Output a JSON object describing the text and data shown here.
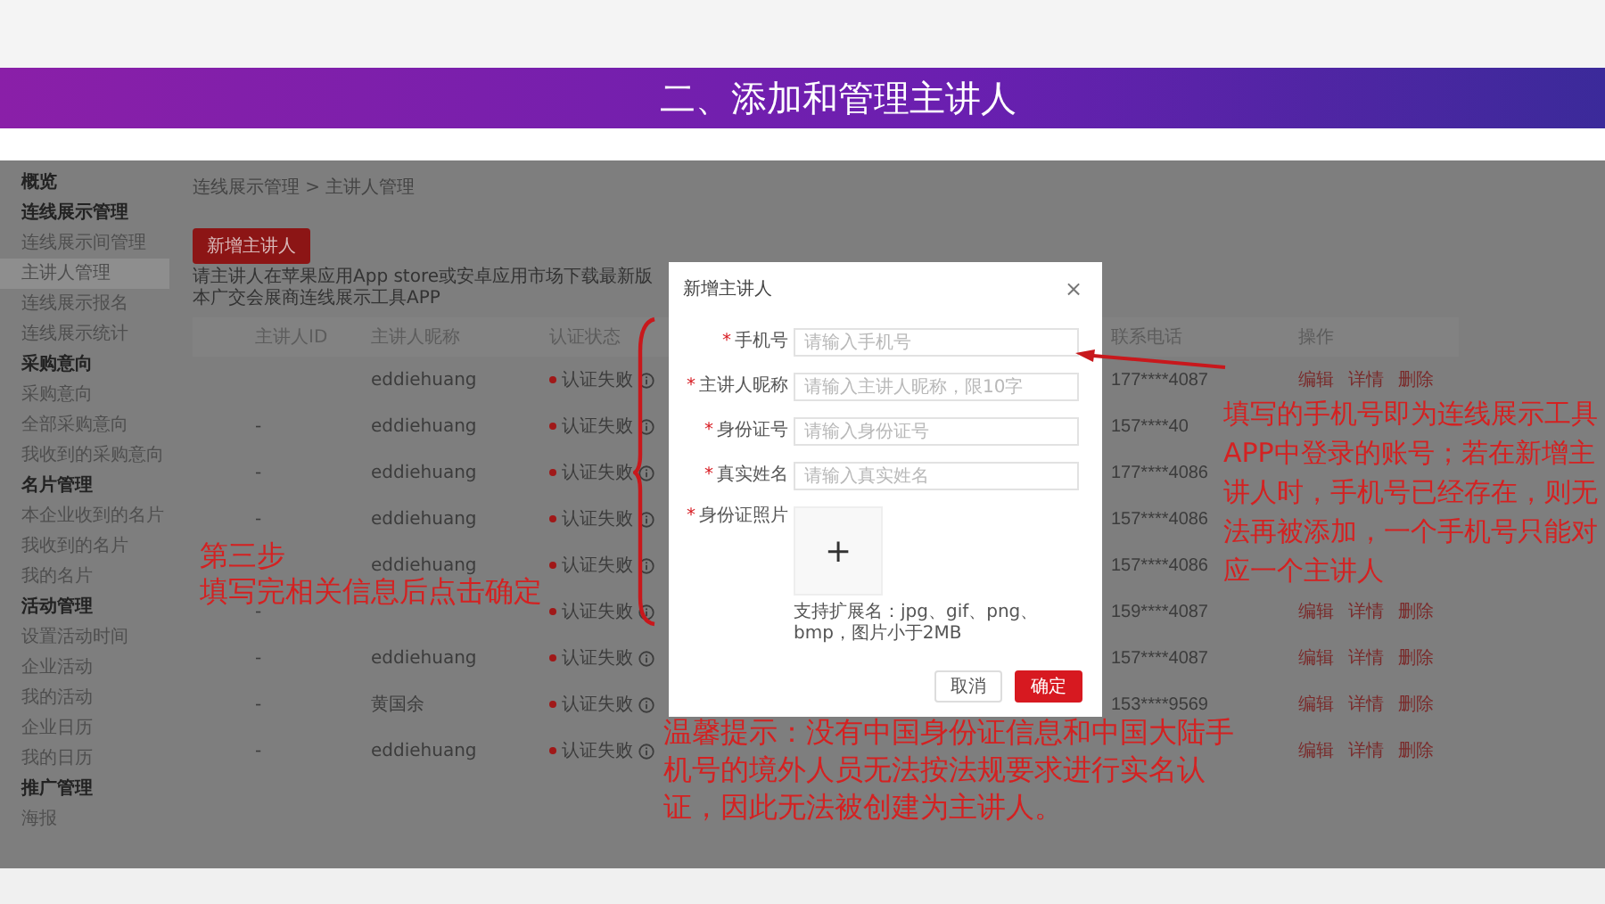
{
  "slide_title": "二、添加和管理主讲人",
  "sidebar": {
    "items": [
      {
        "kind": "group",
        "label": "概览",
        "selected": false
      },
      {
        "kind": "group",
        "label": "连线展示管理",
        "selected": false
      },
      {
        "kind": "item",
        "label": "连线展示间管理",
        "selected": false
      },
      {
        "kind": "item",
        "label": "主讲人管理",
        "selected": true
      },
      {
        "kind": "item",
        "label": "连线展示报名",
        "selected": false
      },
      {
        "kind": "item",
        "label": "连线展示统计",
        "selected": false
      },
      {
        "kind": "group",
        "label": "采购意向",
        "selected": false
      },
      {
        "kind": "item",
        "label": "采购意向",
        "selected": false
      },
      {
        "kind": "item",
        "label": "全部采购意向",
        "selected": false
      },
      {
        "kind": "item",
        "label": "我收到的采购意向",
        "selected": false
      },
      {
        "kind": "group",
        "label": "名片管理",
        "selected": false
      },
      {
        "kind": "item",
        "label": "本企业收到的名片",
        "selected": false
      },
      {
        "kind": "item",
        "label": "我收到的名片",
        "selected": false
      },
      {
        "kind": "item",
        "label": "我的名片",
        "selected": false
      },
      {
        "kind": "group",
        "label": "活动管理",
        "selected": false
      },
      {
        "kind": "item",
        "label": "设置活动时间",
        "selected": false
      },
      {
        "kind": "item",
        "label": "企业活动",
        "selected": false
      },
      {
        "kind": "item",
        "label": "我的活动",
        "selected": false
      },
      {
        "kind": "item",
        "label": "企业日历",
        "selected": false
      },
      {
        "kind": "item",
        "label": "我的日历",
        "selected": false
      },
      {
        "kind": "group",
        "label": "推广管理",
        "selected": false
      },
      {
        "kind": "item",
        "label": "海报",
        "selected": false
      }
    ]
  },
  "breadcrumb": "连线展示管理 > 主讲人管理",
  "add_button": "新增主讲人",
  "notice": "请主讲人在苹果应用App store或安卓应用市场下载最新版本广交会展商连线展示工具APP",
  "table": {
    "columns": [
      "主讲人ID",
      "主讲人昵称",
      "认证状态",
      "联系电话",
      "操作"
    ],
    "rows": [
      {
        "nickname": "eddiehuang",
        "status": "认证失败",
        "phone": "177****4087",
        "actions": [
          "编辑",
          "详情",
          "删除"
        ]
      },
      {
        "id": "-",
        "nickname": "eddiehuang",
        "status": "认证失败",
        "phone": "157****40"
      },
      {
        "id": "-",
        "nickname": "eddiehuang",
        "status": "认证失败",
        "phone": "177****4086"
      },
      {
        "id": "-",
        "nickname": "eddiehuang",
        "status": "认证失败",
        "phone": "157****4086"
      },
      {
        "nickname": "eddiehuang",
        "status": "认证失败",
        "phone": "157****4086"
      },
      {
        "id": "-",
        "status": "认证失败",
        "phone": "159****4087",
        "actions": [
          "编辑",
          "详情",
          "删除"
        ]
      },
      {
        "id": "-",
        "nickname": "eddiehuang",
        "status": "认证失败",
        "phone": "157****4087",
        "actions": [
          "编辑",
          "详情",
          "删除"
        ]
      },
      {
        "id": "-",
        "nickname": "黄国余",
        "status": "认证失败",
        "phone": "153****9569",
        "actions": [
          "编辑",
          "详情",
          "删除"
        ]
      },
      {
        "id": "-",
        "nickname": "eddiehuang",
        "status": "认证失败",
        "actions": [
          "编辑",
          "详情",
          "删除"
        ]
      }
    ]
  },
  "dialog": {
    "title": "新增主讲人",
    "close": "×",
    "fields": [
      {
        "mark": "*",
        "label": "手机号",
        "placeholder": "请输入手机号"
      },
      {
        "mark": "*",
        "label": "主讲人昵称",
        "placeholder": "请输入主讲人昵称，限10字"
      },
      {
        "mark": "*",
        "label": "身份证号",
        "placeholder": "请输入身份证号"
      },
      {
        "mark": "*",
        "label": "真实姓名",
        "placeholder": "请输入真实姓名"
      }
    ],
    "upload": {
      "mark": "*",
      "label": "身份证照片",
      "icon": "+",
      "hint": "支持扩展名：jpg、gif、png、bmp，图片小于2MB"
    },
    "buttons": [
      {
        "label": "取消",
        "kind": "default"
      },
      {
        "label": "确定",
        "kind": "primary"
      }
    ]
  },
  "annotations": [
    {
      "kind": "step",
      "lines": [
        "第三步",
        "填写完相关信息后点击确定"
      ]
    },
    {
      "kind": "phone_note",
      "lines": [
        "填写的手机号即为连线展示工具APP中登录的账号；若在新增主讲人时，手机号已经存在，则无法再被添加，一个手机号只能对应一个主讲人"
      ]
    },
    {
      "kind": "tip",
      "lines": [
        "温馨提示：没有中国身份证信息和中国大陆手机号的境外人员无法按法规要求进行实名认证，因此无法被创建为主讲人。"
      ]
    }
  ]
}
